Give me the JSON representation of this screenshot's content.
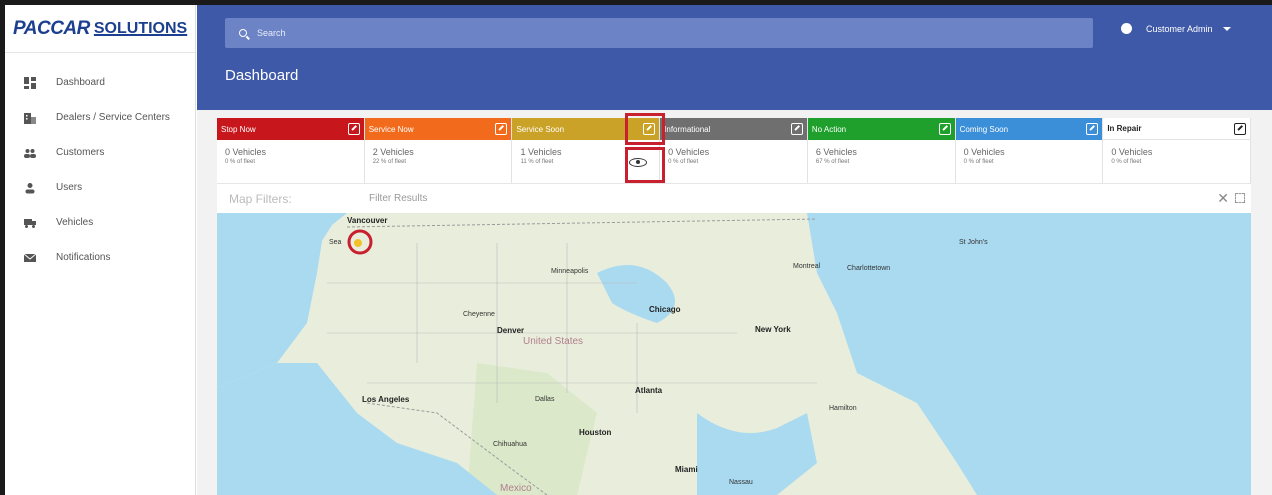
{
  "brand": {
    "logo_text": "PACCAR",
    "logo_suffix": "SOLUTIONS"
  },
  "sidebar": {
    "items": [
      {
        "label": "Dashboard",
        "icon": "dashboard-icon"
      },
      {
        "label": "Dealers / Service Centers",
        "icon": "building-icon"
      },
      {
        "label": "Customers",
        "icon": "people-icon"
      },
      {
        "label": "Users",
        "icon": "person-icon"
      },
      {
        "label": "Vehicles",
        "icon": "truck-icon"
      },
      {
        "label": "Notifications",
        "icon": "mail-icon"
      }
    ]
  },
  "topbar": {
    "search_placeholder": "Search",
    "user_label": "Customer Admin"
  },
  "page": {
    "title": "Dashboard"
  },
  "cards": [
    {
      "title": "Stop Now",
      "color": "#c8161d",
      "count": "0 Vehicles",
      "pct": "0 % of fleet"
    },
    {
      "title": "Service Now",
      "color": "#f26b1d",
      "count": "2 Vehicles",
      "pct": "22 % of fleet"
    },
    {
      "title": "Service Soon",
      "color": "#c9a227",
      "count": "1 Vehicles",
      "pct": "11 % of fleet"
    },
    {
      "title": "Informational",
      "color": "#6f6f6f",
      "count": "0 Vehicles",
      "pct": "0 % of fleet"
    },
    {
      "title": "No Action",
      "color": "#1f9f2b",
      "count": "6 Vehicles",
      "pct": "67 % of fleet"
    },
    {
      "title": "Coming Soon",
      "color": "#3b8fd8",
      "count": "0 Vehicles",
      "pct": "0 % of fleet"
    },
    {
      "title": "In Repair",
      "color": "#ffffff",
      "count": "0 Vehicles",
      "pct": "0 % of fleet"
    }
  ],
  "filters": {
    "label": "Map Filters:",
    "placeholder": "Filter Results",
    "close": "✕"
  },
  "map": {
    "labels": {
      "vancouver": "Vancouver",
      "seattle": "Sea",
      "minneapolis": "Minneapolis",
      "chicago": "Chicago",
      "newyork": "New York",
      "denver": "Denver",
      "cheyenne": "Cheyenne",
      "us": "United States",
      "la": "Los Angeles",
      "dallas": "Dallas",
      "houston": "Houston",
      "atlanta": "Atlanta",
      "miami": "Miami",
      "mexico": "Mexico",
      "montreal": "Montreal",
      "stjohns": "St John's",
      "charlottetown": "Charlottetown",
      "hamilton": "Hamilton",
      "chihuahua": "Chihuahua",
      "nassau": "Nassau"
    }
  }
}
